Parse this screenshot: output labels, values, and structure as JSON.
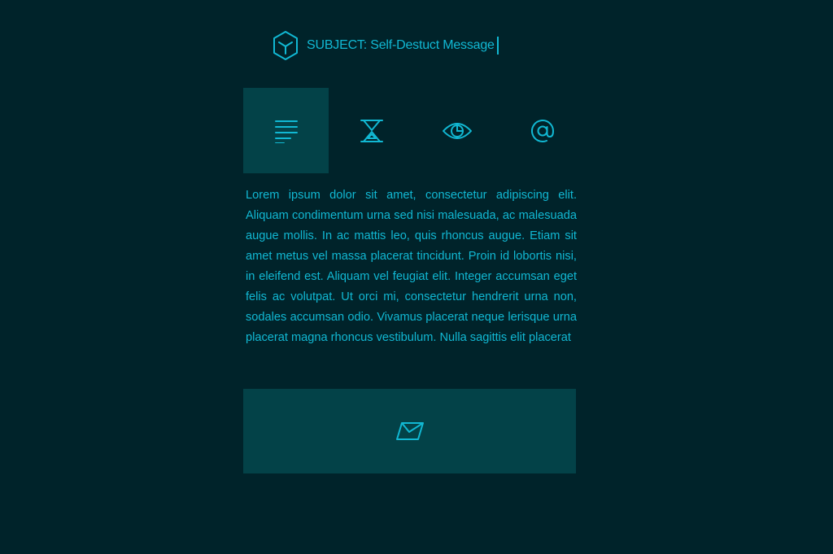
{
  "header": {
    "logo_icon": "hexagon-logo-icon",
    "subject": "SUBJECT: Self-Destuct Message"
  },
  "tabs": [
    {
      "icon": "text-lines-icon",
      "active": true
    },
    {
      "icon": "hourglass-icon",
      "active": false
    },
    {
      "icon": "eye-icon",
      "active": false
    },
    {
      "icon": "at-sign-icon",
      "active": false
    }
  ],
  "message": {
    "body": "Lorem ipsum dolor sit amet, consectetur adipiscing elit. Aliquam condimentum urna sed nisi malesuada, ac malesuada augue mollis. In ac mattis leo, quis rhoncus augue. Etiam sit amet metus vel massa placerat tincidunt. Proin id lobortis nisi, in eleifend est. Aliquam vel feugiat elit. Integer accumsan eget felis ac volutpat. Ut orci mi, consectetur hendrerit urna non, sodales accumsan odio. Vivamus placerat neque lerisque urna placerat magna rhoncus vestibulum. Nulla sagittis elit placerat"
  },
  "send_button": {
    "icon": "envelope-icon"
  },
  "colors": {
    "background": "#00232a",
    "panel": "#034248",
    "accent": "#11b8d3"
  }
}
